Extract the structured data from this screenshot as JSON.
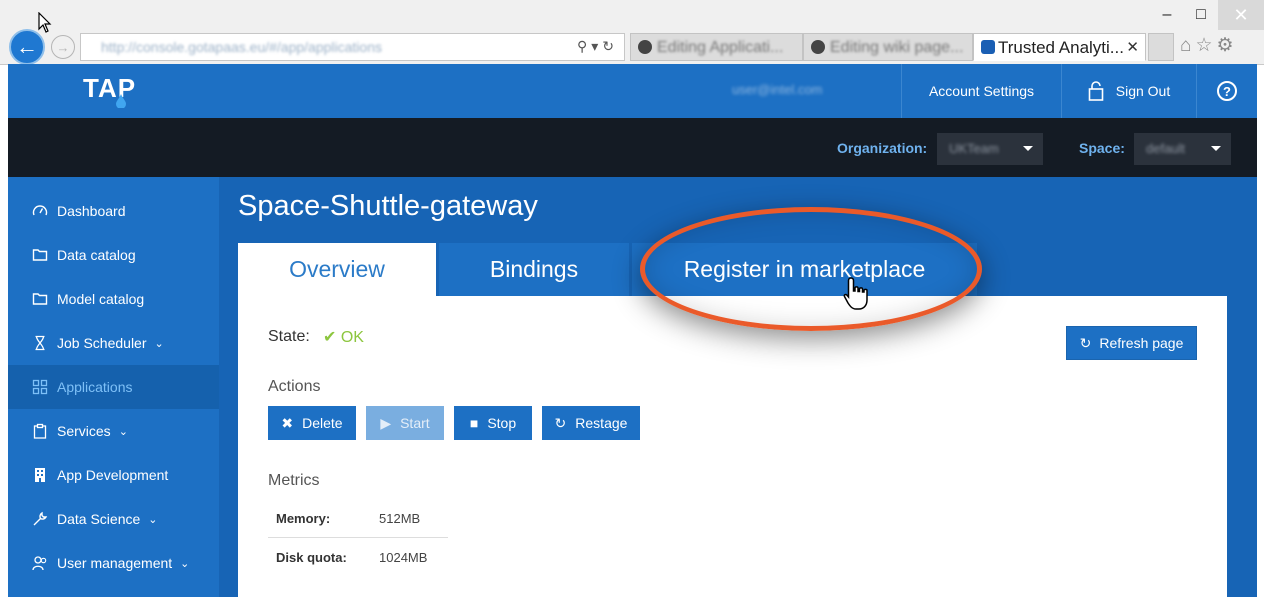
{
  "browser": {
    "address_url": "http://console.gotapaas.eu/#/app/applications",
    "tabs": [
      {
        "label": "Editing Applicati..."
      },
      {
        "label": "Editing wiki page..."
      },
      {
        "label": "Trusted Analyti..."
      }
    ]
  },
  "header": {
    "logo": "TAP",
    "user_email": "user@intel.com",
    "account_settings": "Account Settings",
    "sign_out": "Sign Out"
  },
  "org_bar": {
    "org_label": "Organization:",
    "org_value": "UKTeam",
    "space_label": "Space:",
    "space_value": "default"
  },
  "sidebar": {
    "items": [
      {
        "label": "Dashboard",
        "icon": "dashboard-icon"
      },
      {
        "label": "Data catalog",
        "icon": "folder-icon"
      },
      {
        "label": "Model catalog",
        "icon": "folder-icon"
      },
      {
        "label": "Job Scheduler",
        "icon": "hourglass-icon"
      },
      {
        "label": "Applications",
        "icon": "grid-icon"
      },
      {
        "label": "Services",
        "icon": "clipboard-icon"
      },
      {
        "label": "App Development",
        "icon": "building-icon"
      },
      {
        "label": "Data Science",
        "icon": "wrench-icon"
      },
      {
        "label": "User management",
        "icon": "users-icon"
      }
    ]
  },
  "main": {
    "title": "Space-Shuttle-gateway",
    "tabs": [
      {
        "label": "Overview"
      },
      {
        "label": "Bindings"
      },
      {
        "label": "Register in marketplace"
      }
    ],
    "state_label": "State:",
    "state_value": "OK",
    "refresh_label": "Refresh page",
    "actions_heading": "Actions",
    "actions": [
      {
        "label": "Delete"
      },
      {
        "label": "Start"
      },
      {
        "label": "Stop"
      },
      {
        "label": "Restage"
      }
    ],
    "metrics_heading": "Metrics",
    "metrics": [
      {
        "key": "Memory:",
        "value": "512MB"
      },
      {
        "key": "Disk quota:",
        "value": "1024MB"
      }
    ]
  },
  "colors": {
    "brand_blue": "#1d70c4",
    "dark_bar": "#141b24",
    "ok_green": "#8dc63f",
    "highlight_orange": "#ea5a2a"
  }
}
